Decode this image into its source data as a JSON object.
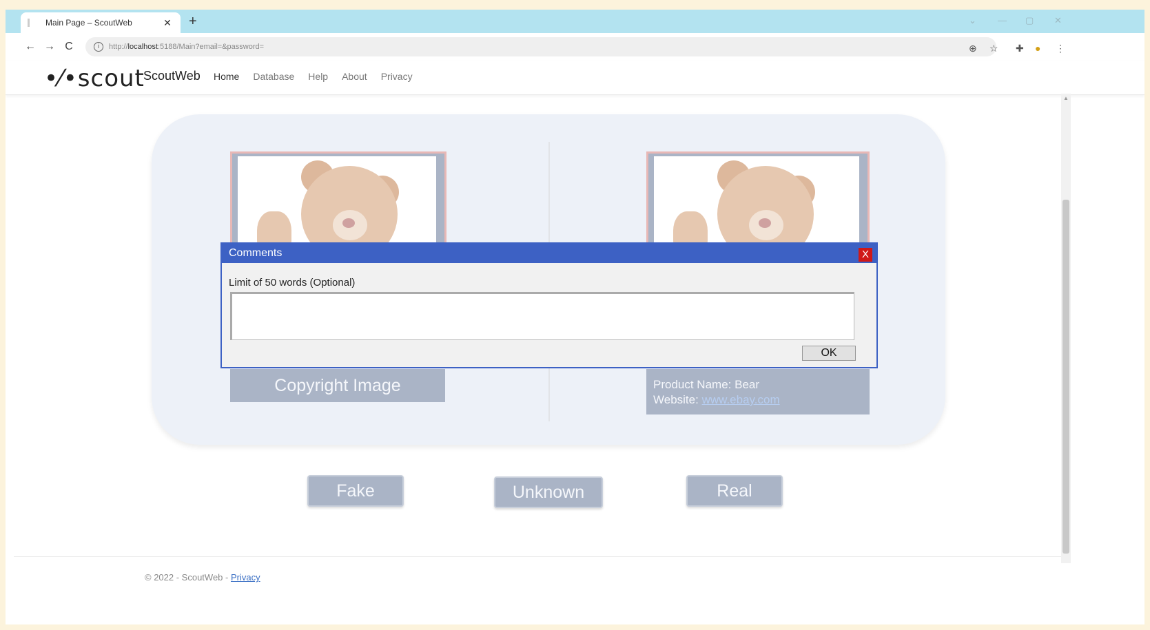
{
  "browser": {
    "tab_title": "Main Page – ScoutWeb",
    "tab_close": "✕",
    "new_tab": "+",
    "url_prefix": "http://",
    "url_host": "localhost",
    "url_rest": ":5188/Main?email=&password=",
    "info_icon": "i",
    "back": "←",
    "forward": "→",
    "reload": "C",
    "min": "—",
    "max": "▢",
    "close": "✕",
    "chevron": "⌄"
  },
  "site": {
    "logo": "scout",
    "brand": "ScoutWeb",
    "nav": [
      "Home",
      "Database",
      "Help",
      "About",
      "Privacy"
    ]
  },
  "left_panel": {
    "caption": "Copyright Image"
  },
  "right_panel": {
    "product_label": "Product Name: Bear",
    "website_label": "Website:",
    "website_link": "www.ebay.com"
  },
  "buttons": {
    "fake": "Fake",
    "unknown": "Unknown",
    "real": "Real"
  },
  "modal": {
    "title": "Comments",
    "close": "X",
    "hint": "Limit of 50 words (Optional)",
    "textarea_value": "",
    "ok": "OK"
  },
  "footer": {
    "text": "© 2022 - ScoutWeb -",
    "privacy": "Privacy"
  },
  "colors": {
    "modal_header": "#3d61c4",
    "close_red": "#d01818",
    "disabled_button": "#aab4c6",
    "panel_bg": "#edf1f8",
    "tab_strip": "#b3e3f0"
  }
}
